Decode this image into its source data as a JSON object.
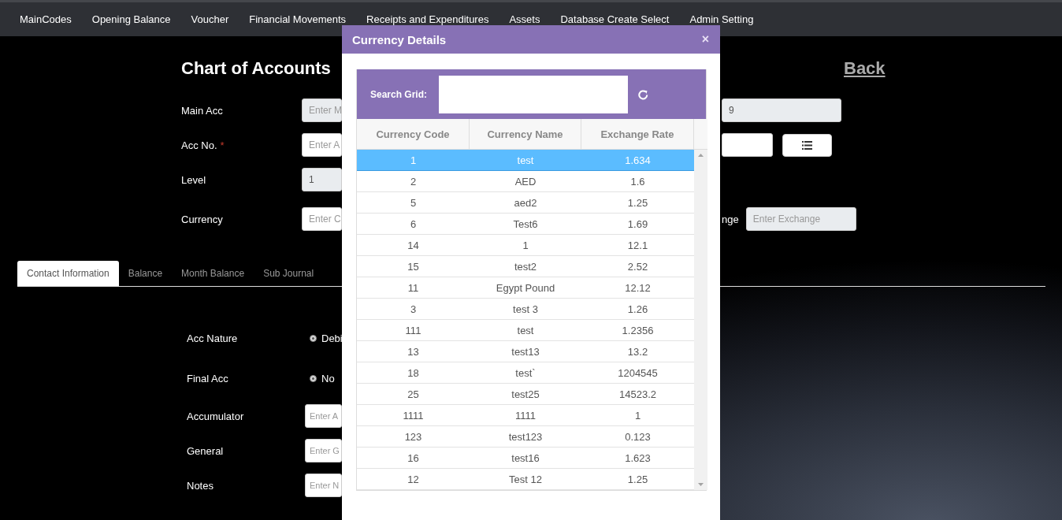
{
  "nav": {
    "items": [
      "MainCodes",
      "Opening Balance",
      "Voucher",
      "Financial Movements",
      "Receipts and Expenditures",
      "Assets",
      "Database Create Select",
      "Admin Setting"
    ]
  },
  "page": {
    "title": "Chart of Accounts",
    "back_link": "Back"
  },
  "form_rows": [
    {
      "label": "Main Acc",
      "field": {
        "placeholder": "Enter M",
        "disabled": true
      },
      "right_field": {
        "value": "9",
        "disabled": true
      }
    },
    {
      "label": "Acc No.",
      "required_mark": "*",
      "field": {
        "placeholder": "Enter A",
        "disabled": false
      },
      "right_field": {
        "disabled": false
      },
      "list_button": true
    },
    {
      "label": "Level",
      "field": {
        "value": "1",
        "disabled": true
      }
    },
    {
      "label": "Currency",
      "field": {
        "placeholder": "Enter C",
        "disabled": false
      },
      "right_label": "nge",
      "right_field": {
        "placeholder": "Enter Exchange",
        "disabled": true
      }
    }
  ],
  "tabs": [
    {
      "label": "Contact Information",
      "selected": true
    },
    {
      "label": "Balance",
      "selected": false
    },
    {
      "label": "Month Balance",
      "selected": false
    },
    {
      "label": "Sub Journal",
      "selected": false
    }
  ],
  "details": [
    {
      "label": "Acc Nature",
      "kind": "radio",
      "option": "Debi",
      "checked": true
    },
    {
      "label": "Final Acc",
      "kind": "radio",
      "option": "No",
      "checked": true
    },
    {
      "label": "Accumulator",
      "kind": "field",
      "placeholder": "Enter A"
    },
    {
      "label": "General",
      "kind": "field",
      "placeholder": "Enter G"
    },
    {
      "label": "Notes",
      "kind": "field",
      "placeholder": "Enter N"
    }
  ],
  "modal": {
    "title": "Currency Details",
    "close": "×",
    "search": {
      "label": "Search Grid:"
    },
    "columns": [
      "Currency Code",
      "Currency Name",
      "Exchange Rate"
    ],
    "rows": [
      {
        "cells": [
          "1",
          "test",
          "1.634"
        ],
        "selected": true
      },
      {
        "cells": [
          "2",
          "AED",
          "1.6"
        ],
        "selected": false
      },
      {
        "cells": [
          "5",
          "aed2",
          "1.25"
        ],
        "selected": false
      },
      {
        "cells": [
          "6",
          "Test6",
          "1.69"
        ],
        "selected": false
      },
      {
        "cells": [
          "14",
          "1",
          "12.1"
        ],
        "selected": false
      },
      {
        "cells": [
          "15",
          "test2",
          "2.52"
        ],
        "selected": false
      },
      {
        "cells": [
          "11",
          "Egypt Pound",
          "12.12"
        ],
        "selected": false
      },
      {
        "cells": [
          "3",
          "test 3",
          "1.26"
        ],
        "selected": false
      },
      {
        "cells": [
          "111",
          "test",
          "1.2356"
        ],
        "selected": false
      },
      {
        "cells": [
          "13",
          "test13",
          "13.2"
        ],
        "selected": false
      },
      {
        "cells": [
          "18",
          "test`",
          "1204545"
        ],
        "selected": false
      },
      {
        "cells": [
          "25",
          "test25",
          "14523.2"
        ],
        "selected": false
      },
      {
        "cells": [
          "1111",
          "1111",
          "1"
        ],
        "selected": false
      },
      {
        "cells": [
          "123",
          "test123",
          "0.123"
        ],
        "selected": false
      },
      {
        "cells": [
          "16",
          "test16",
          "1.623"
        ],
        "selected": false
      },
      {
        "cells": [
          "12",
          "Test 12",
          "1.25"
        ],
        "selected": false
      }
    ]
  }
}
